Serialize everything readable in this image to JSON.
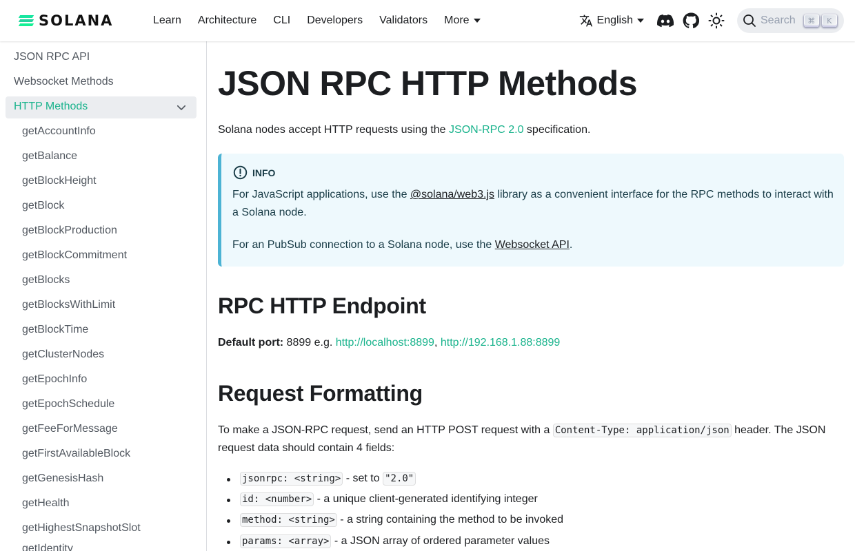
{
  "navbar": {
    "brand": "SOLANA",
    "links": [
      "Learn",
      "Architecture",
      "CLI",
      "Developers",
      "Validators",
      "More"
    ],
    "language": "English",
    "search_placeholder": "Search",
    "search_keys": [
      "⌘",
      "K"
    ],
    "icons": [
      "translate-icon",
      "discord-icon",
      "github-icon",
      "theme-toggle-icon",
      "search-icon"
    ]
  },
  "sidebar": {
    "items": [
      "JSON RPC API",
      "Websocket Methods",
      "HTTP Methods"
    ],
    "sub_items": [
      "getAccountInfo",
      "getBalance",
      "getBlockHeight",
      "getBlock",
      "getBlockProduction",
      "getBlockCommitment",
      "getBlocks",
      "getBlocksWithLimit",
      "getBlockTime",
      "getClusterNodes",
      "getEpochInfo",
      "getEpochSchedule",
      "getFeeForMessage",
      "getFirstAvailableBlock",
      "getGenesisHash",
      "getHealth",
      "getHighestSnapshotSlot",
      "getIdentity"
    ]
  },
  "colors": {
    "accent": "#19b38c",
    "info_border": "#4cb3d4",
    "info_bg": "#eef9fd"
  },
  "main": {
    "title": "JSON RPC HTTP Methods",
    "intro": {
      "before": "Solana nodes accept HTTP requests using the ",
      "link": "JSON-RPC 2.0",
      "after": " specification."
    },
    "info": {
      "label": "INFO",
      "p1_before": "For JavaScript applications, use the ",
      "p1_link": "@solana/web3.js",
      "p1_after": " library as a convenient interface for the RPC methods to interact with a Solana node.",
      "p2_before": "For an PubSub connection to a Solana node, use the ",
      "p2_link": "Websocket API",
      "p2_after": "."
    },
    "endpoint": {
      "heading": "RPC HTTP Endpoint",
      "label": "Default port:",
      "text": " 8899 e.g. ",
      "link1": "http://localhost:8899",
      "sep": ", ",
      "link2": "http://192.168.1.88:8899"
    },
    "formatting": {
      "heading": "Request Formatting",
      "p_before": "To make a JSON-RPC request, send an HTTP POST request with a ",
      "p_code": "Content-Type: application/json",
      "p_after": " header. The JSON request data should contain 4 fields:",
      "fields": [
        {
          "code": "jsonrpc: <string>",
          "text": " - set to ",
          "code2": "\"2.0\""
        },
        {
          "code": "id: <number>",
          "text": " - a unique client-generated identifying integer"
        },
        {
          "code": "method: <string>",
          "text": " - a string containing the method to be invoked"
        },
        {
          "code": "params: <array>",
          "text": " - a JSON array of ordered parameter values"
        }
      ]
    }
  }
}
